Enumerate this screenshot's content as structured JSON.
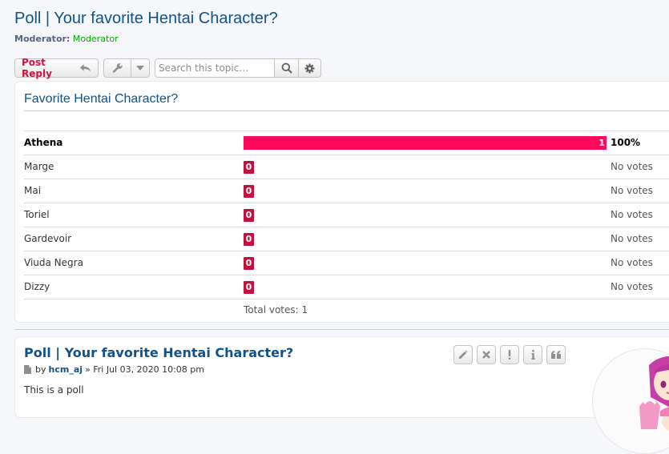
{
  "topic": {
    "title": "Poll | Your favorite Hentai Character?",
    "moderator_label": "Moderator:",
    "moderator_name": "Moderator"
  },
  "actions": {
    "post_reply_label": "Post Reply",
    "search_placeholder": "Search this topic…"
  },
  "poll": {
    "question": "Favorite Hentai Character?",
    "options": [
      {
        "name": "Athena",
        "votes": "1",
        "result": "100%",
        "percent": 100
      },
      {
        "name": "Marge",
        "votes": "0",
        "result": "No votes",
        "percent": 0
      },
      {
        "name": "Mai",
        "votes": "0",
        "result": "No votes",
        "percent": 0
      },
      {
        "name": "Toriel",
        "votes": "0",
        "result": "No votes",
        "percent": 0
      },
      {
        "name": "Gardevoir",
        "votes": "0",
        "result": "No votes",
        "percent": 0
      },
      {
        "name": "Viuda Negra",
        "votes": "0",
        "result": "No votes",
        "percent": 0
      },
      {
        "name": "Dizzy",
        "votes": "0",
        "result": "No votes",
        "percent": 0
      }
    ],
    "total_votes": "Total votes: 1",
    "bar_color": "#ff0a5a",
    "zero_color": "#c3113d"
  },
  "post": {
    "title": "Poll | Your favorite Hentai Character?",
    "by": "by",
    "author": "hcm_aj",
    "date": "» Fri Jul 03, 2020 10:08 pm",
    "body": "This is a poll",
    "buttons": [
      "pencil-icon",
      "close-icon",
      "warning-icon",
      "info-icon",
      "quote-icon"
    ]
  }
}
